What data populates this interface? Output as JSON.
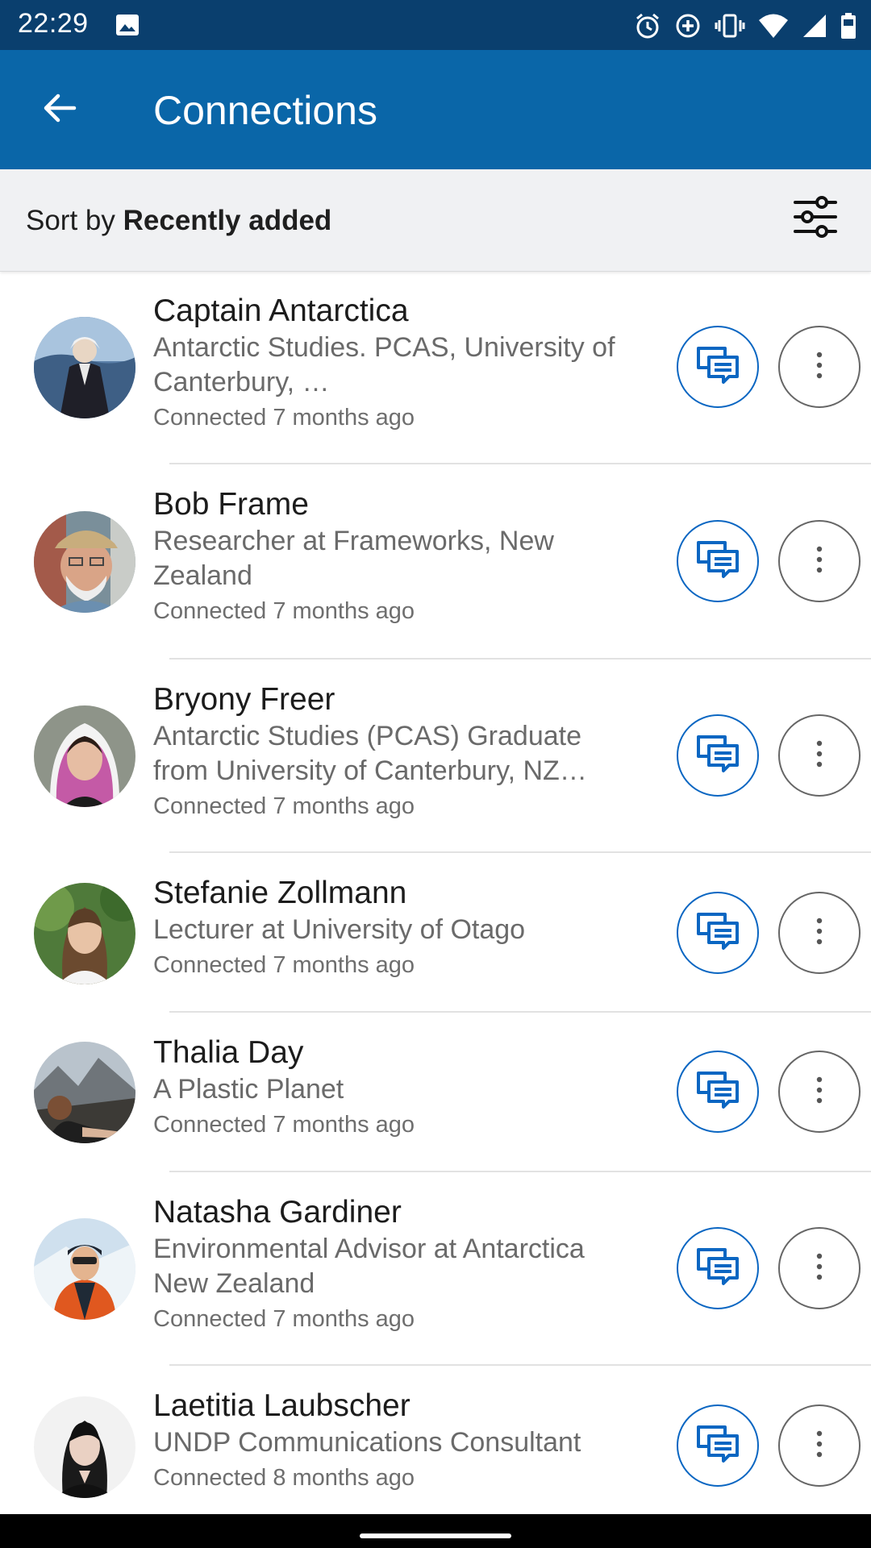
{
  "status_bar": {
    "time": "22:29",
    "icons": [
      "image-icon",
      "alarm-icon",
      "data-saver-icon",
      "vibrate-icon",
      "wifi-icon",
      "signal-icon",
      "battery-icon"
    ]
  },
  "app_bar": {
    "title": "Connections",
    "back_icon": "arrow-back-icon"
  },
  "sort": {
    "prefix": "Sort by",
    "value": "Recently added",
    "filter_icon": "sliders-icon"
  },
  "connections": [
    {
      "name": "Captain Antarctica",
      "headline_line1": "Antarctic Studies. PCAS, University of",
      "headline_line2": "Canterbury,  …",
      "connected": "Connected 7 months ago"
    },
    {
      "name": "Bob Frame",
      "headline_line1": "Researcher at Frameworks, New",
      "headline_line2": "Zealand",
      "connected": "Connected 7 months ago"
    },
    {
      "name": "Bryony Freer",
      "headline_line1": "Antarctic Studies (PCAS) Graduate",
      "headline_line2": "from University of Canterbury, NZ…",
      "connected": "Connected 7 months ago"
    },
    {
      "name": "Stefanie Zollmann",
      "headline_line1": "Lecturer at University of Otago",
      "headline_line2": "",
      "connected": "Connected 7 months ago"
    },
    {
      "name": "Thalia Day",
      "headline_line1": "A Plastic Planet",
      "headline_line2": "",
      "connected": "Connected 7 months ago"
    },
    {
      "name": "Natasha Gardiner",
      "headline_line1": "Environmental Advisor at Antarctica",
      "headline_line2": "New Zealand",
      "connected": "Connected 7 months ago"
    },
    {
      "name": "Laetitia Laubscher",
      "headline_line1": "UNDP Communications Consultant",
      "headline_line2": "",
      "connected": "Connected 8 months ago"
    }
  ],
  "colors": {
    "status_bar": "#0a3f6e",
    "app_bar": "#0a66a8",
    "accent": "#0a66c2"
  }
}
